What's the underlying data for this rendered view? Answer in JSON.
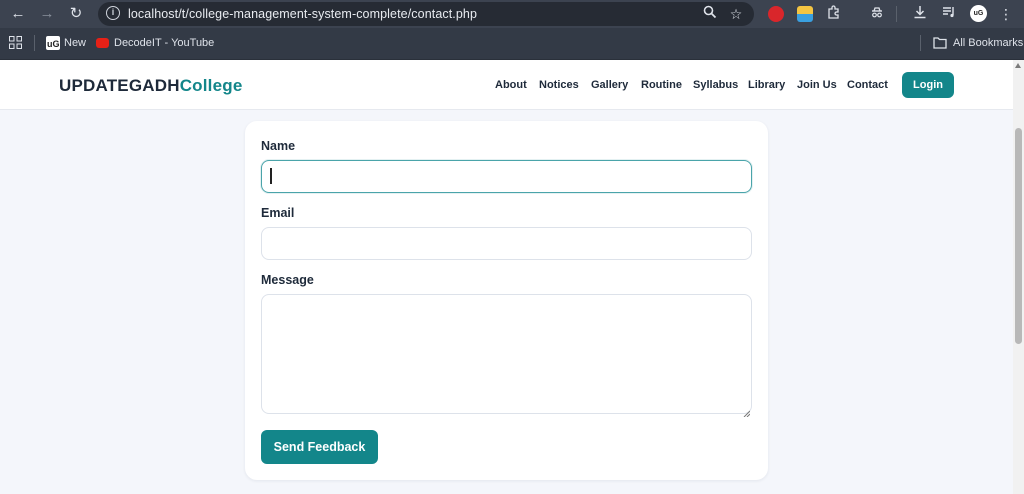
{
  "browser": {
    "url": "localhost/t/college-management-system-complete/contact.php",
    "bookmarks": [
      {
        "label": "New"
      },
      {
        "label": "DecodeIT - YouTube"
      }
    ],
    "all_bookmarks_label": "All Bookmarks",
    "profile_initials": "uG"
  },
  "site": {
    "brand_main": "UPDATEGADH",
    "brand_accent": "College",
    "accent_color": "#13868a",
    "nav": [
      "About",
      "Notices",
      "Gallery",
      "Routine",
      "Syllabus",
      "Library",
      "Join Us",
      "Contact"
    ],
    "login_label": "Login"
  },
  "form": {
    "name_label": "Name",
    "name_value": "",
    "email_label": "Email",
    "email_value": "",
    "message_label": "Message",
    "message_value": "",
    "submit_label": "Send Feedback"
  }
}
